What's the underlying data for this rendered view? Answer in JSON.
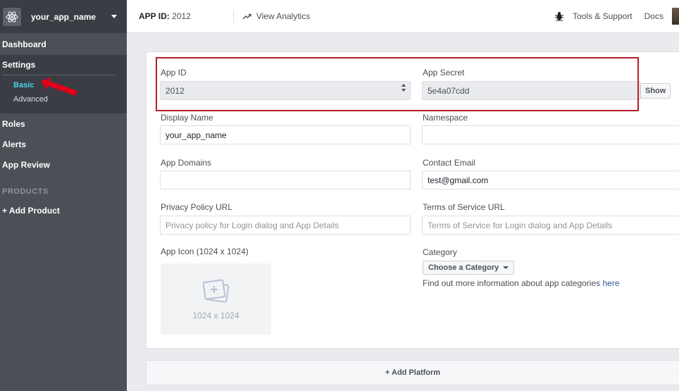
{
  "app": {
    "name": "your_app_name"
  },
  "sidebar": {
    "items": [
      {
        "label": "Dashboard"
      },
      {
        "label": "Settings"
      },
      {
        "label": "Roles"
      },
      {
        "label": "Alerts"
      },
      {
        "label": "App Review"
      }
    ],
    "settings_sub": [
      {
        "label": "Basic",
        "active": true
      },
      {
        "label": "Advanced"
      }
    ],
    "products_header": "PRODUCTS",
    "add_product": "+ Add Product"
  },
  "topbar": {
    "app_id_label": "APP ID:",
    "app_id_value": "2012",
    "view_analytics": "View Analytics",
    "tools_support": "Tools & Support",
    "docs": "Docs"
  },
  "form": {
    "app_id": {
      "label": "App ID",
      "value": "2012"
    },
    "app_secret": {
      "label": "App Secret",
      "value": "5e4a07cdd",
      "show_button": "Show"
    },
    "display_name": {
      "label": "Display Name",
      "value": "your_app_name"
    },
    "namespace": {
      "label": "Namespace",
      "value": ""
    },
    "app_domains": {
      "label": "App Domains",
      "value": ""
    },
    "contact_email": {
      "label": "Contact Email",
      "value": "test@gmail.com"
    },
    "privacy_url": {
      "label": "Privacy Policy URL",
      "placeholder": "Privacy policy for Login dialog and App Details"
    },
    "tos_url": {
      "label": "Terms of Service URL",
      "placeholder": "Terms of Service for Login dialog and App Details"
    },
    "app_icon": {
      "label": "App Icon (1024 x 1024)",
      "size_text": "1024 x 1024"
    },
    "category": {
      "label": "Category",
      "button": "Choose a Category",
      "info": "Find out more information about app categories",
      "link": "here"
    }
  },
  "add_platform": "+ Add Platform",
  "colors": {
    "sidebar": "#4b4f56",
    "active_sub": "#4ccff1",
    "highlight": "#b4202a",
    "link": "#365899"
  }
}
